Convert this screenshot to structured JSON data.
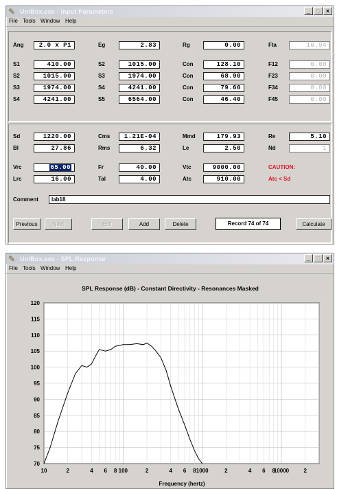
{
  "input_window": {
    "title": "UniBox.exe - Input Parameters",
    "menu": [
      "File",
      "Tools",
      "Window",
      "Help"
    ],
    "params": {
      "ang": {
        "label": "Ang",
        "value": "2.0 x Pi"
      },
      "eg": {
        "label": "Eg",
        "value": "2.83"
      },
      "rg": {
        "label": "Rg",
        "value": "0.00"
      },
      "fta": {
        "label": "Fta",
        "value": "10.94"
      },
      "s1": {
        "label": "S1",
        "value": "410.00"
      },
      "s2": {
        "label": "S2",
        "value": "1015.00"
      },
      "s3": {
        "label": "S3",
        "value": "1974.00"
      },
      "s4": {
        "label": "S4",
        "value": "4241.00"
      },
      "s2b": {
        "label": "S2",
        "value": "1015.00"
      },
      "s3b": {
        "label": "S3",
        "value": "1974.00"
      },
      "s4b": {
        "label": "S4",
        "value": "4241.00"
      },
      "s5": {
        "label": "S5",
        "value": "6564.00"
      },
      "con1": {
        "label": "Con",
        "value": "128.10"
      },
      "con2": {
        "label": "Con",
        "value": "68.90"
      },
      "con3": {
        "label": "Con",
        "value": "79.60"
      },
      "con4": {
        "label": "Con",
        "value": "46.40"
      },
      "f12": {
        "label": "F12",
        "value": "0.00"
      },
      "f23": {
        "label": "F23",
        "value": "0.00"
      },
      "f34": {
        "label": "F34",
        "value": "0.00"
      },
      "f45": {
        "label": "F45",
        "value": "0.00"
      },
      "sd": {
        "label": "Sd",
        "value": "1220.00"
      },
      "bl": {
        "label": "Bl",
        "value": "27.86"
      },
      "cms": {
        "label": "Cms",
        "value": "1.21E-04"
      },
      "rms": {
        "label": "Rms",
        "value": "6.32"
      },
      "mmd": {
        "label": "Mmd",
        "value": "179.93"
      },
      "le": {
        "label": "Le",
        "value": "2.50"
      },
      "re": {
        "label": "Re",
        "value": "5.10"
      },
      "nd": {
        "label": "Nd",
        "value": "1"
      },
      "vrc": {
        "label": "Vrc",
        "value": "65.00"
      },
      "lrc": {
        "label": "Lrc",
        "value": "16.00"
      },
      "fr": {
        "label": "Fr",
        "value": "40.00"
      },
      "tal": {
        "label": "Tal",
        "value": "4.00"
      },
      "vtc": {
        "label": "Vtc",
        "value": "9000.00"
      },
      "atc": {
        "label": "Atc",
        "value": "910.00"
      }
    },
    "caution": "CAUTION:",
    "caution_detail": "Atc < Sd",
    "comment_label": "Comment",
    "comment_value": "lab18",
    "buttons": {
      "previous": "Previous",
      "next": "Next",
      "edit": "Edit",
      "add": "Add",
      "delete": "Delete",
      "calculate": "Calculate"
    },
    "record": "Record 74 of 74"
  },
  "spl_window": {
    "title": "UniBox.exe - SPL Response",
    "menu": [
      "File",
      "Tools",
      "Window",
      "Help"
    ]
  },
  "chart_data": {
    "type": "line",
    "title": "SPL Response (dB) - Constant Directivity - Resonances Masked",
    "xlabel": "Frequency (hertz)",
    "ylabel": "",
    "x_scale": "log",
    "xlim": [
      10,
      30000
    ],
    "ylim": [
      70,
      120
    ],
    "y_ticks": [
      70,
      75,
      80,
      85,
      90,
      95,
      100,
      105,
      110,
      115,
      120
    ],
    "x_tick_labels": [
      "10",
      "2",
      "4",
      "6",
      "8",
      "100",
      "2",
      "4",
      "6",
      "8",
      "1000",
      "2",
      "4",
      "6",
      "8",
      "10000",
      "2"
    ],
    "x_tick_values": [
      10,
      20,
      40,
      60,
      80,
      100,
      200,
      400,
      600,
      800,
      1000,
      2000,
      4000,
      6000,
      8000,
      10000,
      20000
    ],
    "grid": true,
    "series": [
      {
        "name": "",
        "color": "#000000",
        "x": [
          10,
          12,
          15,
          20,
          25,
          30,
          35,
          40,
          45,
          50,
          60,
          70,
          80,
          100,
          120,
          150,
          180,
          200,
          230,
          260,
          300,
          350,
          400,
          500,
          600,
          700,
          800,
          900,
          1000
        ],
        "y": [
          70,
          75,
          83,
          92,
          98,
          100.5,
          100,
          101,
          103.5,
          105.5,
          105,
          105.5,
          106.5,
          107,
          107,
          107.3,
          107,
          107.5,
          106.5,
          105,
          103,
          99,
          94,
          87,
          82,
          77.5,
          74,
          71.5,
          70
        ]
      }
    ]
  },
  "colors": {
    "window_face": "#d6d3ce",
    "title_gradient": "#c8ccd4",
    "caution": "#e0102a",
    "selection": "#0a246a"
  }
}
